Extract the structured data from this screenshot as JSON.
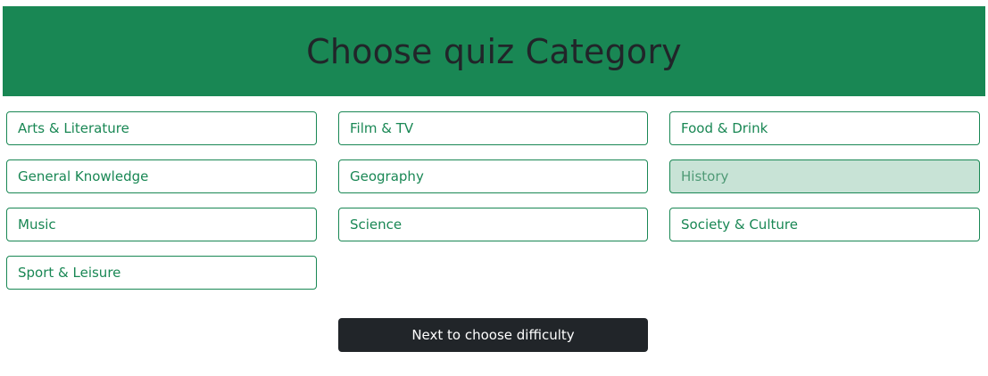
{
  "header": {
    "title": "Choose quiz Category"
  },
  "categories": [
    {
      "label": "Arts & Literature",
      "selected": false
    },
    {
      "label": "Film & TV",
      "selected": false
    },
    {
      "label": "Food & Drink",
      "selected": false
    },
    {
      "label": "General Knowledge",
      "selected": false
    },
    {
      "label": "Geography",
      "selected": false
    },
    {
      "label": "History",
      "selected": true
    },
    {
      "label": "Music",
      "selected": false
    },
    {
      "label": "Science",
      "selected": false
    },
    {
      "label": "Society & Culture",
      "selected": false
    },
    {
      "label": "Sport & Leisure",
      "selected": false
    }
  ],
  "actions": {
    "next_label": "Next to choose difficulty"
  },
  "colors": {
    "header_bg": "#198754",
    "title_text": "#212529",
    "category_border": "#198754",
    "category_selected_bg": "#c8e3d6",
    "next_button_bg": "#212529"
  }
}
